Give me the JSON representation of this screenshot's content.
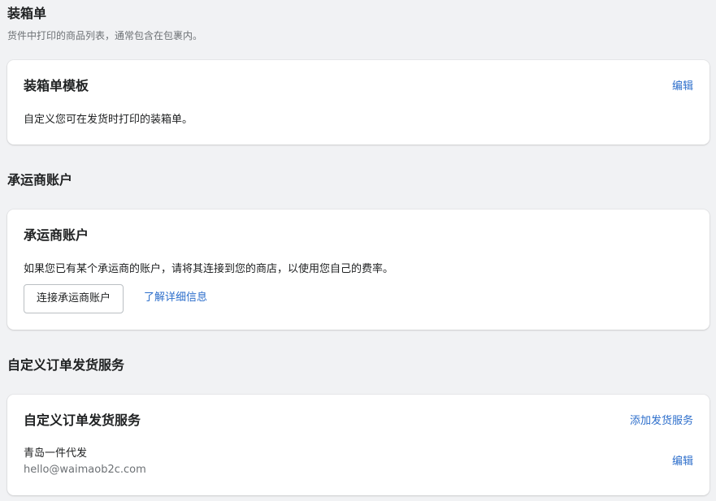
{
  "packing_slip": {
    "section_title": "装箱单",
    "section_desc": "货件中打印的商品列表，通常包含在包裹内。",
    "card_title": "装箱单模板",
    "edit_label": "编辑",
    "card_text": "自定义您可在发货时打印的装箱单。"
  },
  "carrier": {
    "section_title": "承运商账户",
    "card_title": "承运商账户",
    "card_text": "如果您已有某个承运商的账户，请将其连接到您的商店，以使用您自己的费率。",
    "connect_button": "连接承运商账户",
    "learn_more": "了解详细信息"
  },
  "fulfillment": {
    "section_title": "自定义订单发货服务",
    "card_title": "自定义订单发货服务",
    "add_label": "添加发货服务",
    "service_name": "青岛一件代发",
    "service_email": "hello@waimaob2c.com",
    "edit_label": "编辑"
  }
}
